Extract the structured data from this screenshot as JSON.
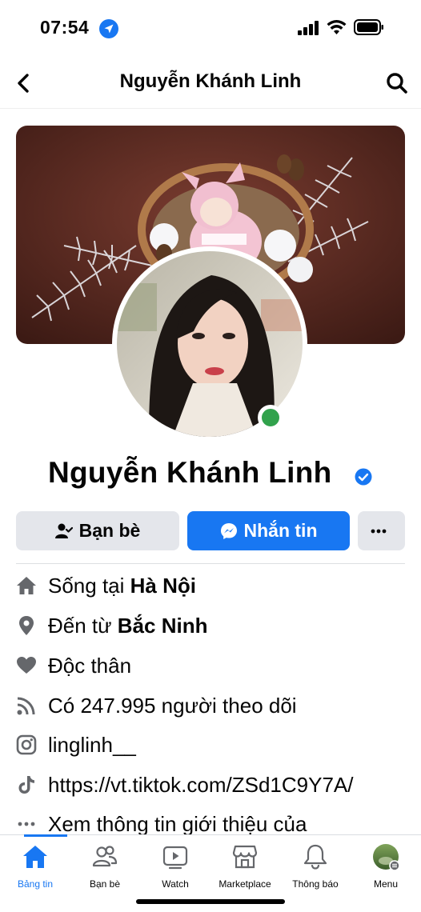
{
  "status_bar": {
    "time": "07:54"
  },
  "header": {
    "title": "Nguyễn Khánh Linh"
  },
  "profile": {
    "name": "Nguyễn Khánh Linh",
    "online": true,
    "verified": true
  },
  "actions": {
    "friends_label": "Bạn bè",
    "message_label": "Nhắn tin",
    "more_label": "···"
  },
  "intro": [
    {
      "icon": "home-icon",
      "prefix": "Sống tại ",
      "value": "Hà Nội"
    },
    {
      "icon": "location-pin-icon",
      "prefix": "Đến từ ",
      "value": "Bắc Ninh"
    },
    {
      "icon": "heart-icon",
      "prefix": "",
      "value": "Độc thân"
    },
    {
      "icon": "rss-icon",
      "prefix": "Có ",
      "value": "247.995 người theo dõi"
    },
    {
      "icon": "instagram-icon",
      "prefix": "",
      "value": "linglinh__"
    },
    {
      "icon": "tiktok-icon",
      "prefix": "",
      "value": "https://vt.tiktok.com/ZSd1C9Y7A/"
    },
    {
      "icon": "more-dots-icon",
      "prefix": "",
      "value": "Xem thông tin giới thiệu của"
    }
  ],
  "tabbar": [
    {
      "label": "Bảng tin",
      "icon": "home-icon",
      "active": true
    },
    {
      "label": "Bạn bè",
      "icon": "friends-icon",
      "active": false
    },
    {
      "label": "Watch",
      "icon": "watch-icon",
      "active": false
    },
    {
      "label": "Marketplace",
      "icon": "marketplace-icon",
      "active": false
    },
    {
      "label": "Thông báo",
      "icon": "bell-icon",
      "active": false
    },
    {
      "label": "Menu",
      "icon": "menu-avatar-icon",
      "active": false
    }
  ],
  "colors": {
    "accent": "#1877f2",
    "online": "#31a24c",
    "button_gray": "#e4e6eb"
  }
}
